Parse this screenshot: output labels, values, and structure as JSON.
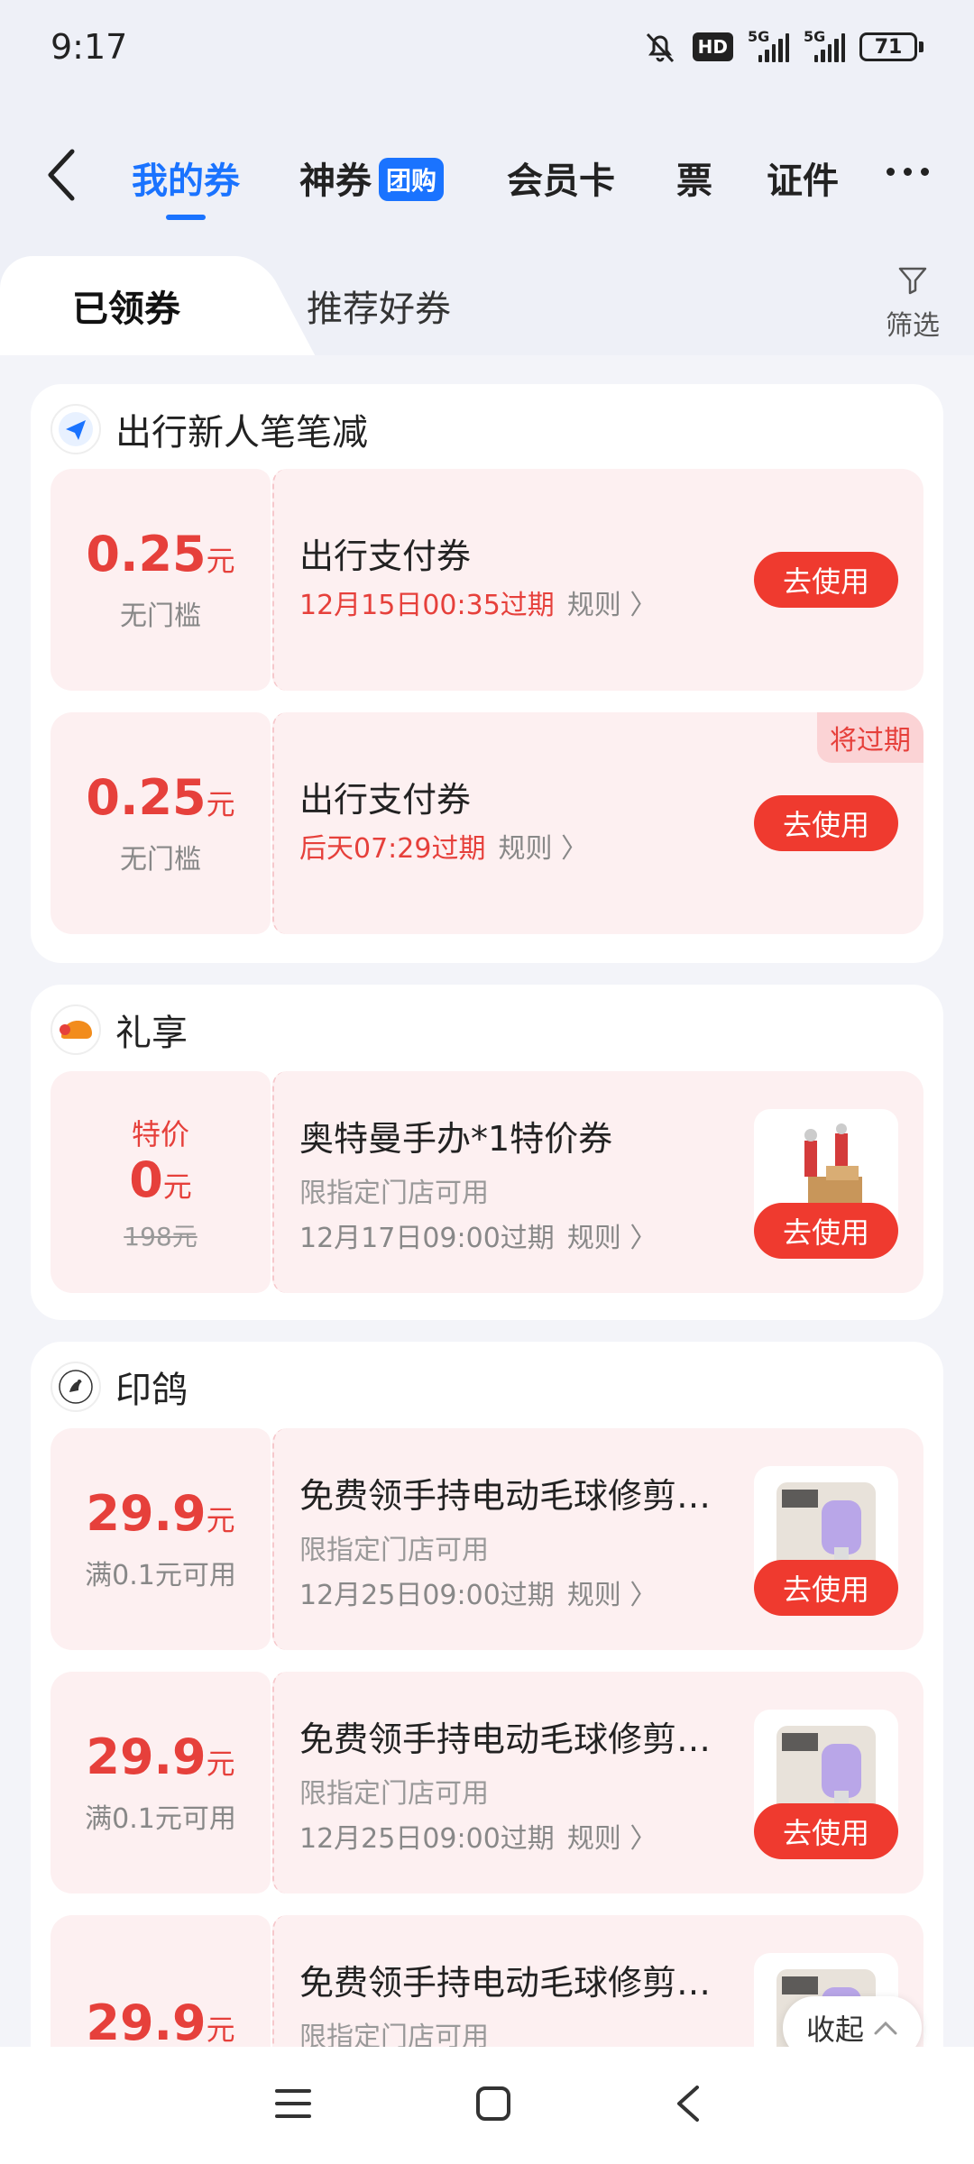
{
  "status_bar": {
    "time": "9:17",
    "hd": "HD",
    "net1": "5G",
    "net2": "5G",
    "battery": "71"
  },
  "nav": {
    "tabs": [
      {
        "label": "我的券"
      },
      {
        "label": "神券",
        "badge": "团购"
      },
      {
        "label": "会员卡"
      },
      {
        "label": "票"
      },
      {
        "label": "证件"
      }
    ]
  },
  "subtabs": {
    "active": "已领券",
    "other": "推荐好券",
    "filter": "筛选"
  },
  "groups": [
    {
      "brand": "出行新人笔笔减",
      "coupons": [
        {
          "amount": "0.25",
          "unit": "元",
          "condition": "无门槛",
          "title": "出行支付券",
          "expiry": "12月15日00:35过期",
          "rule": "规则 〉",
          "button": "去使用"
        },
        {
          "amount": "0.25",
          "unit": "元",
          "condition": "无门槛",
          "title": "出行支付券",
          "expiry": "后天07:29过期",
          "rule": "规则 〉",
          "button": "去使用",
          "tag": "将过期"
        }
      ]
    },
    {
      "brand": "礼享",
      "coupons": [
        {
          "label": "特价",
          "amount": "0",
          "unit": "元",
          "original": "198元",
          "title": "奥特曼手办*1特价券",
          "store": "限指定门店可用",
          "expiry": "12月17日09:00过期",
          "rule": "规则 〉",
          "button": "去使用"
        }
      ]
    },
    {
      "brand": "印鸽",
      "coupons": [
        {
          "amount": "29.9",
          "unit": "元",
          "condition": "满0.1元可用",
          "title": "免费领手持电动毛球修剪…",
          "store": "限指定门店可用",
          "expiry": "12月25日09:00过期",
          "rule": "规则 〉",
          "button": "去使用"
        },
        {
          "amount": "29.9",
          "unit": "元",
          "condition": "满0.1元可用",
          "title": "免费领手持电动毛球修剪…",
          "store": "限指定门店可用",
          "expiry": "12月25日09:00过期",
          "rule": "规则 〉",
          "button": "去使用"
        },
        {
          "amount": "29.9",
          "unit": "元",
          "title": "免费领手持电动毛球修剪…",
          "store": "限指定门店可用"
        }
      ]
    }
  ],
  "collapse": "收起",
  "colors": {
    "accent_blue": "#1a73ff",
    "coupon_red": "#e6403b",
    "button_red": "#ef3a2f",
    "coupon_bg": "#fdf0f1"
  }
}
